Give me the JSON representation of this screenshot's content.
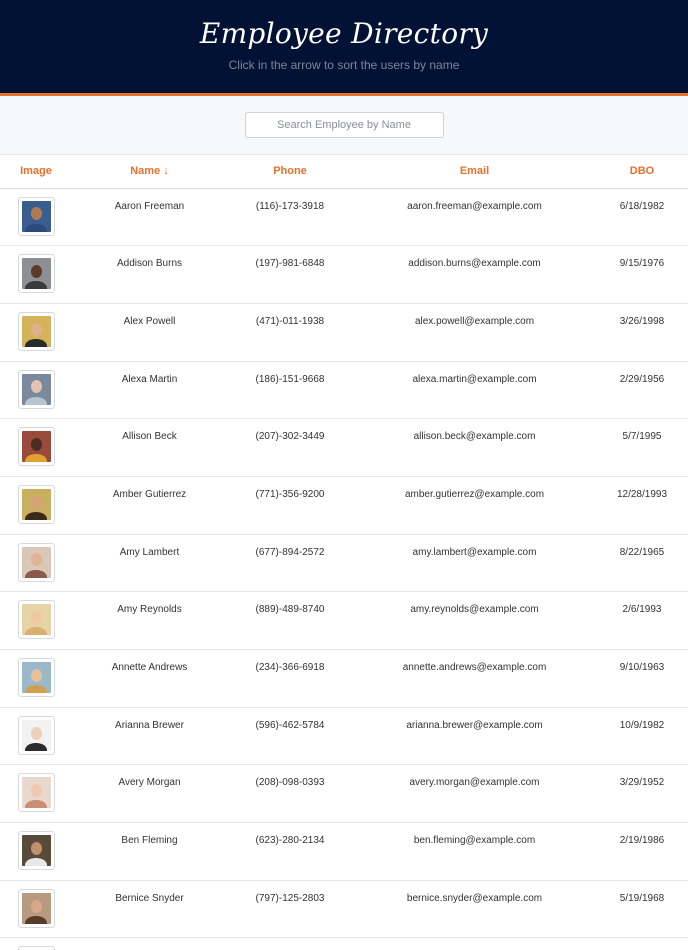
{
  "header": {
    "title": "Employee Directory",
    "subtitle": "Click in the arrow to sort the users by name"
  },
  "search": {
    "placeholder": "Search Employee by Name"
  },
  "table": {
    "columns": {
      "image": "Image",
      "name": "Name",
      "name_sort_icon": "↓",
      "phone": "Phone",
      "email": "Email",
      "dob": "DBO"
    },
    "rows": [
      {
        "name": "Aaron Freeman",
        "phone": "(116)-173-3918",
        "email": "aaron.freeman@example.com",
        "dob": "6/18/1982",
        "bg": "#3a5d8f",
        "skin": "#b07a55",
        "shirt": "#2b4a7a"
      },
      {
        "name": "Addison Burns",
        "phone": "(197)-981-6848",
        "email": "addison.burns@example.com",
        "dob": "9/15/1976",
        "bg": "#8c8f93",
        "skin": "#5b3a2a",
        "shirt": "#3a3a3a"
      },
      {
        "name": "Alex Powell",
        "phone": "(471)-011-1938",
        "email": "alex.powell@example.com",
        "dob": "3/26/1998",
        "bg": "#d6b35a",
        "skin": "#e0b08a",
        "shirt": "#2a2a2a"
      },
      {
        "name": "Alexa Martin",
        "phone": "(186)-151-9668",
        "email": "alexa.martin@example.com",
        "dob": "2/29/1956",
        "bg": "#7a8a9c",
        "skin": "#e6c3b0",
        "shirt": "#b8c4d0"
      },
      {
        "name": "Allison Beck",
        "phone": "(207)-302-3449",
        "email": "allison.beck@example.com",
        "dob": "5/7/1995",
        "bg": "#9a4a3a",
        "skin": "#4a2e22",
        "shirt": "#e0a030"
      },
      {
        "name": "Amber Gutierrez",
        "phone": "(771)-356-9200",
        "email": "amber.gutierrez@example.com",
        "dob": "12/28/1993",
        "bg": "#c9b060",
        "skin": "#d7a27a",
        "shirt": "#3a2a1a"
      },
      {
        "name": "Amy Lambert",
        "phone": "(677)-894-2572",
        "email": "amy.lambert@example.com",
        "dob": "8/22/1965",
        "bg": "#d9c7b8",
        "skin": "#e2b393",
        "shirt": "#8a5a4a"
      },
      {
        "name": "Amy Reynolds",
        "phone": "(889)-489-8740",
        "email": "amy.reynolds@example.com",
        "dob": "2/6/1993",
        "bg": "#e8d3a8",
        "skin": "#f0c8a0",
        "shirt": "#d9b070"
      },
      {
        "name": "Annette Andrews",
        "phone": "(234)-366-6918",
        "email": "annette.andrews@example.com",
        "dob": "9/10/1963",
        "bg": "#9ab8c8",
        "skin": "#e8c09a",
        "shirt": "#d0a050"
      },
      {
        "name": "Arianna Brewer",
        "phone": "(596)-462-5784",
        "email": "arianna.brewer@example.com",
        "dob": "10/9/1982",
        "bg": "#f2f2f2",
        "skin": "#f0d0b8",
        "shirt": "#2a2a2a"
      },
      {
        "name": "Avery Morgan",
        "phone": "(208)-098-0393",
        "email": "avery.morgan@example.com",
        "dob": "3/29/1952",
        "bg": "#e8d8d0",
        "skin": "#f0c8b0",
        "shirt": "#c89070"
      },
      {
        "name": "Ben Fleming",
        "phone": "(623)-280-2134",
        "email": "ben.fleming@example.com",
        "dob": "2/19/1986",
        "bg": "#5a4a3a",
        "skin": "#c09070",
        "shirt": "#e8e8e8"
      },
      {
        "name": "Bernice Snyder",
        "phone": "(797)-125-2803",
        "email": "bernice.snyder@example.com",
        "dob": "5/19/1968",
        "bg": "#b89a80",
        "skin": "#d8a888",
        "shirt": "#5a3a2a"
      },
      {
        "name": "",
        "phone": "",
        "email": "",
        "dob": "",
        "bg": "#d0d0d0",
        "skin": "#d8b090",
        "shirt": "#888888"
      }
    ]
  }
}
